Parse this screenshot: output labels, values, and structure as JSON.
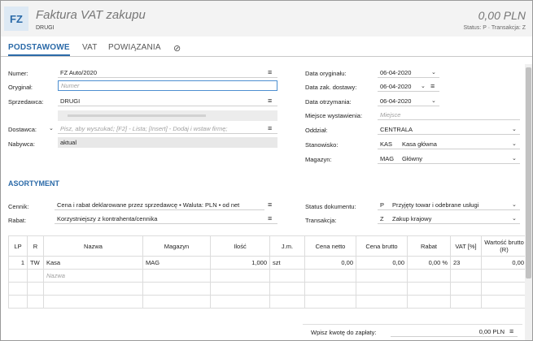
{
  "header": {
    "logo": "FZ",
    "title": "Faktura VAT zakupu",
    "subtitle": "DRUGI",
    "amount": "0,00 PLN",
    "status_line": "Status: P · Transakcja: Z"
  },
  "tabs": [
    {
      "label": "PODSTAWOWE"
    },
    {
      "label": "VAT"
    },
    {
      "label": "POWIĄZANIA"
    }
  ],
  "left": {
    "numer_label": "Numer:",
    "numer_value": "FZ Auto/2020",
    "oryginal_label": "Oryginał:",
    "oryginal_placeholder": "Numer",
    "sprzedawca_label": "Sprzedawca:",
    "sprzedawca_value": "DRUGI",
    "dostawca_label": "Dostawca:",
    "dostawca_placeholder": "Pisz, aby wyszukać; [F2] - Lista; [Insert] - Dodaj i wstaw firmę;",
    "nabywca_label": "Nabywca:",
    "nabywca_value": "aktual"
  },
  "right": {
    "data_oryginalu_label": "Data oryginału:",
    "data_oryginalu_value": "06-04-2020",
    "data_zak_label": "Data zak. dostawy:",
    "data_zak_value": "06-04-2020",
    "data_otrz_label": "Data otrzymania:",
    "data_otrz_value": "06-04-2020",
    "miejsce_label": "Miejsce wystawienia:",
    "miejsce_placeholder": "Miejsce",
    "oddzial_label": "Oddział:",
    "oddzial_value": "CENTRALA",
    "stanowisko_label": "Stanowisko:",
    "stanowisko_code": "KAS",
    "stanowisko_name": "Kasa główna",
    "magazyn_label": "Magazyn:",
    "magazyn_code": "MAG",
    "magazyn_name": "Główny"
  },
  "asortyment": {
    "section_title": "ASORTYMENT",
    "cennik_label": "Cennik:",
    "cennik_value": "Cena i rabat deklarowane przez sprzedawcę • Waluta: PLN • od net",
    "rabat_label": "Rabat:",
    "rabat_value": "Korzystniejszy z kontrahenta/cennika",
    "status_label": "Status dokumentu:",
    "status_code": "P",
    "status_name": "Przyjęty towar i odebrane usługi",
    "transakcja_label": "Transakcja:",
    "transakcja_code": "Z",
    "transakcja_name": "Zakup krajowy"
  },
  "table": {
    "headers": [
      "LP",
      "R",
      "Nazwa",
      "Magazyn",
      "Ilość",
      "J.m.",
      "Cena netto",
      "Cena brutto",
      "Rabat",
      "VAT [%]",
      "Wartość brutto (R)"
    ],
    "rows": [
      [
        "1",
        "TW",
        "Kasa",
        "MAG",
        "1,000",
        "szt",
        "0,00",
        "0,00",
        "0,00 %",
        "23",
        "0,00"
      ]
    ],
    "new_row_placeholder": "Nazwa"
  },
  "footer": {
    "pay_label": "Wpisz kwotę do zapłaty:",
    "pay_value": "0,00 PLN"
  },
  "icons": {
    "menu": "menu-icon",
    "chevron": "chevron-down-icon",
    "attachment": "paperclip-icon"
  }
}
